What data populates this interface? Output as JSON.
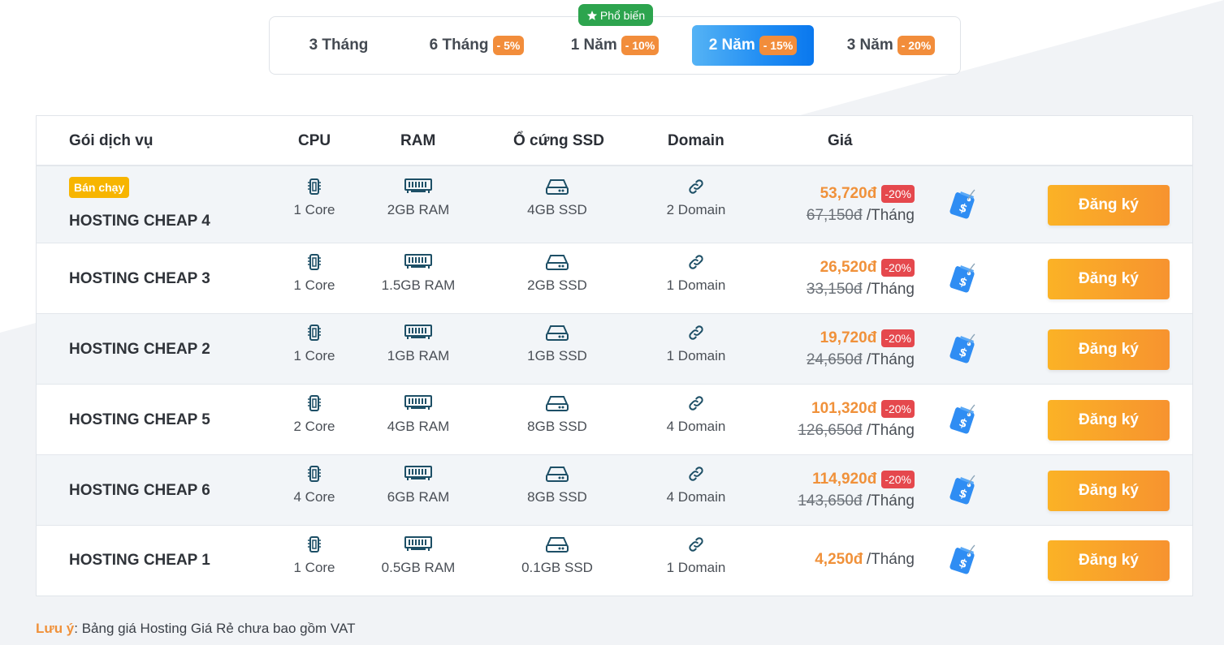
{
  "tabs": [
    {
      "label": "3 Tháng",
      "pct": ""
    },
    {
      "label": "6 Tháng",
      "pct": "- 5%"
    },
    {
      "label": "1 Năm",
      "pct": "- 10%"
    },
    {
      "label": "2 Năm",
      "pct": "- 15%",
      "active": true
    },
    {
      "label": "3 Năm",
      "pct": "- 20%"
    }
  ],
  "popular_badge": "Phổ biến",
  "headers": {
    "plan": "Gói dịch vụ",
    "cpu": "CPU",
    "ram": "RAM",
    "ssd": "Ổ cứng SSD",
    "domain": "Domain",
    "price": "Giá"
  },
  "hot_badge": "Bán chạy",
  "button_label": "Đăng ký",
  "per_month": "/Tháng",
  "rows": [
    {
      "name": "HOSTING CHEAP 4",
      "cpu": "1 Core",
      "ram": "2GB RAM",
      "ssd": "4GB SSD",
      "domain": "2 Domain",
      "price": "53,720đ",
      "discount": "-20%",
      "old_price": "67,150đ"
    },
    {
      "name": "HOSTING CHEAP 3",
      "cpu": "1 Core",
      "ram": "1.5GB RAM",
      "ssd": "2GB SSD",
      "domain": "1 Domain",
      "price": "26,520đ",
      "discount": "-20%",
      "old_price": "33,150đ"
    },
    {
      "name": "HOSTING CHEAP 2",
      "cpu": "1 Core",
      "ram": "1GB RAM",
      "ssd": "1GB SSD",
      "domain": "1 Domain",
      "price": "19,720đ",
      "discount": "-20%",
      "old_price": "24,650đ"
    },
    {
      "name": "HOSTING CHEAP 5",
      "cpu": "2 Core",
      "ram": "4GB RAM",
      "ssd": "8GB SSD",
      "domain": "4 Domain",
      "price": "101,320đ",
      "discount": "-20%",
      "old_price": "126,650đ"
    },
    {
      "name": "HOSTING CHEAP 6",
      "cpu": "4 Core",
      "ram": "6GB RAM",
      "ssd": "8GB SSD",
      "domain": "4 Domain",
      "price": "114,920đ",
      "discount": "-20%",
      "old_price": "143,650đ"
    },
    {
      "name": "HOSTING CHEAP 1",
      "cpu": "1 Core",
      "ram": "0.5GB RAM",
      "ssd": "0.1GB SSD",
      "domain": "1 Domain",
      "price": "4,250đ",
      "discount": "",
      "old_price": ""
    }
  ],
  "note": {
    "label": "Lưu ý",
    "text": ": Bảng giá Hosting Giá Rẻ chưa bao gồm VAT"
  },
  "icons": {
    "cpu": "cpu-chip-icon",
    "ram": "ram-module-icon",
    "ssd": "hard-drive-icon",
    "domain": "link-icon",
    "tag": "price-tag-icon",
    "star": "star-icon"
  },
  "colors": {
    "accent_orange": "#f0913a",
    "active_tab_blue": "#1f8cf3",
    "popular_green": "#2da44e",
    "discount_red": "#e5484d",
    "hot_yellow": "#f7b500"
  }
}
